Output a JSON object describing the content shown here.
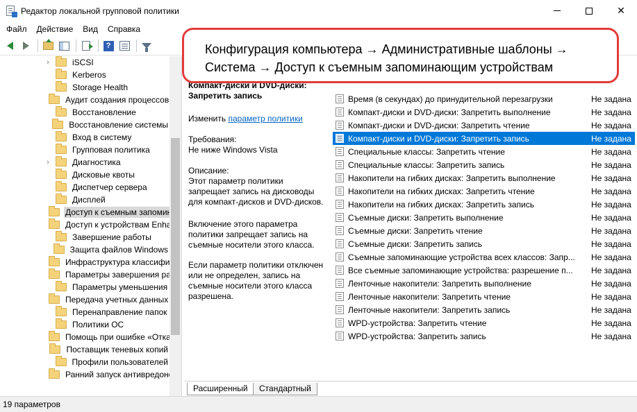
{
  "window": {
    "title": "Редактор локальной групповой политики"
  },
  "menu": [
    "Файл",
    "Действие",
    "Вид",
    "Справка"
  ],
  "tree": {
    "items": [
      {
        "label": "iSCSI",
        "expandable": true
      },
      {
        "label": "Kerberos",
        "expandable": false
      },
      {
        "label": "Storage Health",
        "expandable": false
      },
      {
        "label": "Аудит создания процессов",
        "expandable": false
      },
      {
        "label": "Восстановление",
        "expandable": false
      },
      {
        "label": "Восстановление системы",
        "expandable": false
      },
      {
        "label": "Вход в систему",
        "expandable": false
      },
      {
        "label": "Групповая политика",
        "expandable": false
      },
      {
        "label": "Диагностика",
        "expandable": true
      },
      {
        "label": "Дисковые квоты",
        "expandable": false
      },
      {
        "label": "Диспетчер сервера",
        "expandable": false
      },
      {
        "label": "Дисплей",
        "expandable": false
      },
      {
        "label": "Доступ к съемным запоминающим",
        "expandable": false,
        "selected": true
      },
      {
        "label": "Доступ к устройствам Enhanced Storage",
        "expandable": false
      },
      {
        "label": "Завершение работы",
        "expandable": false
      },
      {
        "label": "Защита файлов Windows",
        "expandable": false
      },
      {
        "label": "Инфраструктура классификации",
        "expandable": false
      },
      {
        "label": "Параметры завершения работы",
        "expandable": false
      },
      {
        "label": "Параметры уменьшения",
        "expandable": false
      },
      {
        "label": "Передача учетных данных",
        "expandable": false
      },
      {
        "label": "Перенаправление папок",
        "expandable": false
      },
      {
        "label": "Политики ОС",
        "expandable": false
      },
      {
        "label": "Помощь при ошибке «Отказано",
        "expandable": false
      },
      {
        "label": "Поставщик теневых копий",
        "expandable": false
      },
      {
        "label": "Профили пользователей",
        "expandable": false
      },
      {
        "label": "Ранний запуск антивредоносной",
        "expandable": false
      }
    ]
  },
  "description": {
    "heading_partial": "Компакт-диски и DVD-диски:",
    "heading": "Запретить запись",
    "edit_prefix": "Изменить ",
    "edit_link": "параметр политики",
    "requirements_label": "Требования:",
    "requirements_value": "Не ниже Windows Vista",
    "description_label": "Описание:",
    "paragraph1": "Этот параметр политики запрещает запись на дисководы для компакт-дисков и DVD-дисков.",
    "paragraph2": "Включение этого параметра политики запрещает запись на съемные носители этого класса.",
    "paragraph3": "Если параметр политики отключен или не определен, запись на съемные носители этого класса разрешена."
  },
  "settings": [
    {
      "name": "Время (в секундах) до принудительной перезагрузки",
      "state": "Не задана"
    },
    {
      "name": "Компакт-диски и DVD-диски: Запретить выполнение",
      "state": "Не задана"
    },
    {
      "name": "Компакт-диски и DVD-диски: Запретить чтение",
      "state": "Не задана"
    },
    {
      "name": "Компакт-диски и DVD-диски: Запретить запись",
      "state": "Не задана",
      "selected": true
    },
    {
      "name": "Специальные классы: Запретить чтение",
      "state": "Не задана"
    },
    {
      "name": "Специальные классы: Запретить запись",
      "state": "Не задана"
    },
    {
      "name": "Накопители на гибких дисках: Запретить выполнение",
      "state": "Не задана"
    },
    {
      "name": "Накопители на гибких дисках: Запретить чтение",
      "state": "Не задана"
    },
    {
      "name": "Накопители на гибких дисках: Запретить запись",
      "state": "Не задана"
    },
    {
      "name": "Съемные диски: Запретить выполнение",
      "state": "Не задана"
    },
    {
      "name": "Съемные диски: Запретить чтение",
      "state": "Не задана"
    },
    {
      "name": "Съемные диски: Запретить запись",
      "state": "Не задана"
    },
    {
      "name": "Съемные запоминающие устройства всех классов: Запр...",
      "state": "Не задана"
    },
    {
      "name": "Все съемные запоминающие устройства: разрешение п...",
      "state": "Не задана"
    },
    {
      "name": "Ленточные накопители: Запретить выполнение",
      "state": "Не задана"
    },
    {
      "name": "Ленточные накопители: Запретить чтение",
      "state": "Не задана"
    },
    {
      "name": "Ленточные накопители: Запретить запись",
      "state": "Не задана"
    },
    {
      "name": "WPD-устройства: Запретить чтение",
      "state": "Не задана"
    },
    {
      "name": "WPD-устройства: Запретить запись",
      "state": "Не задана"
    }
  ],
  "tabs": [
    "Расширенный",
    "Стандартный"
  ],
  "status": "19 параметров",
  "callout": {
    "line1": "Конфигурация компьютера → Административные шаблоны →",
    "line2": "Система → Доступ к съемным запоминающим устройствам",
    "border_color": "#e23b3b"
  },
  "colors": {
    "selection": "#0078d7",
    "link": "#0563c1"
  }
}
